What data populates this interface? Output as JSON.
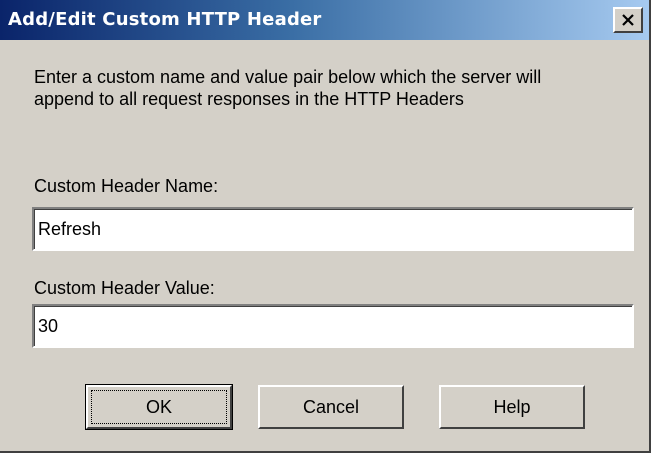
{
  "window": {
    "title": "Add/Edit Custom HTTP Header",
    "close_icon": "close-icon"
  },
  "description": "Enter a custom name and value pair below which the server will append to all request responses in the HTTP Headers",
  "fields": {
    "name_label": "Custom Header Name:",
    "name_value": "Refresh",
    "value_label": "Custom Header Value:",
    "value_value": "30"
  },
  "buttons": {
    "ok": "OK",
    "cancel": "Cancel",
    "help": "Help"
  },
  "colors": {
    "title_start": "#0a246a",
    "title_end": "#a6caf0",
    "dialog_bg": "#d4d0c8"
  }
}
